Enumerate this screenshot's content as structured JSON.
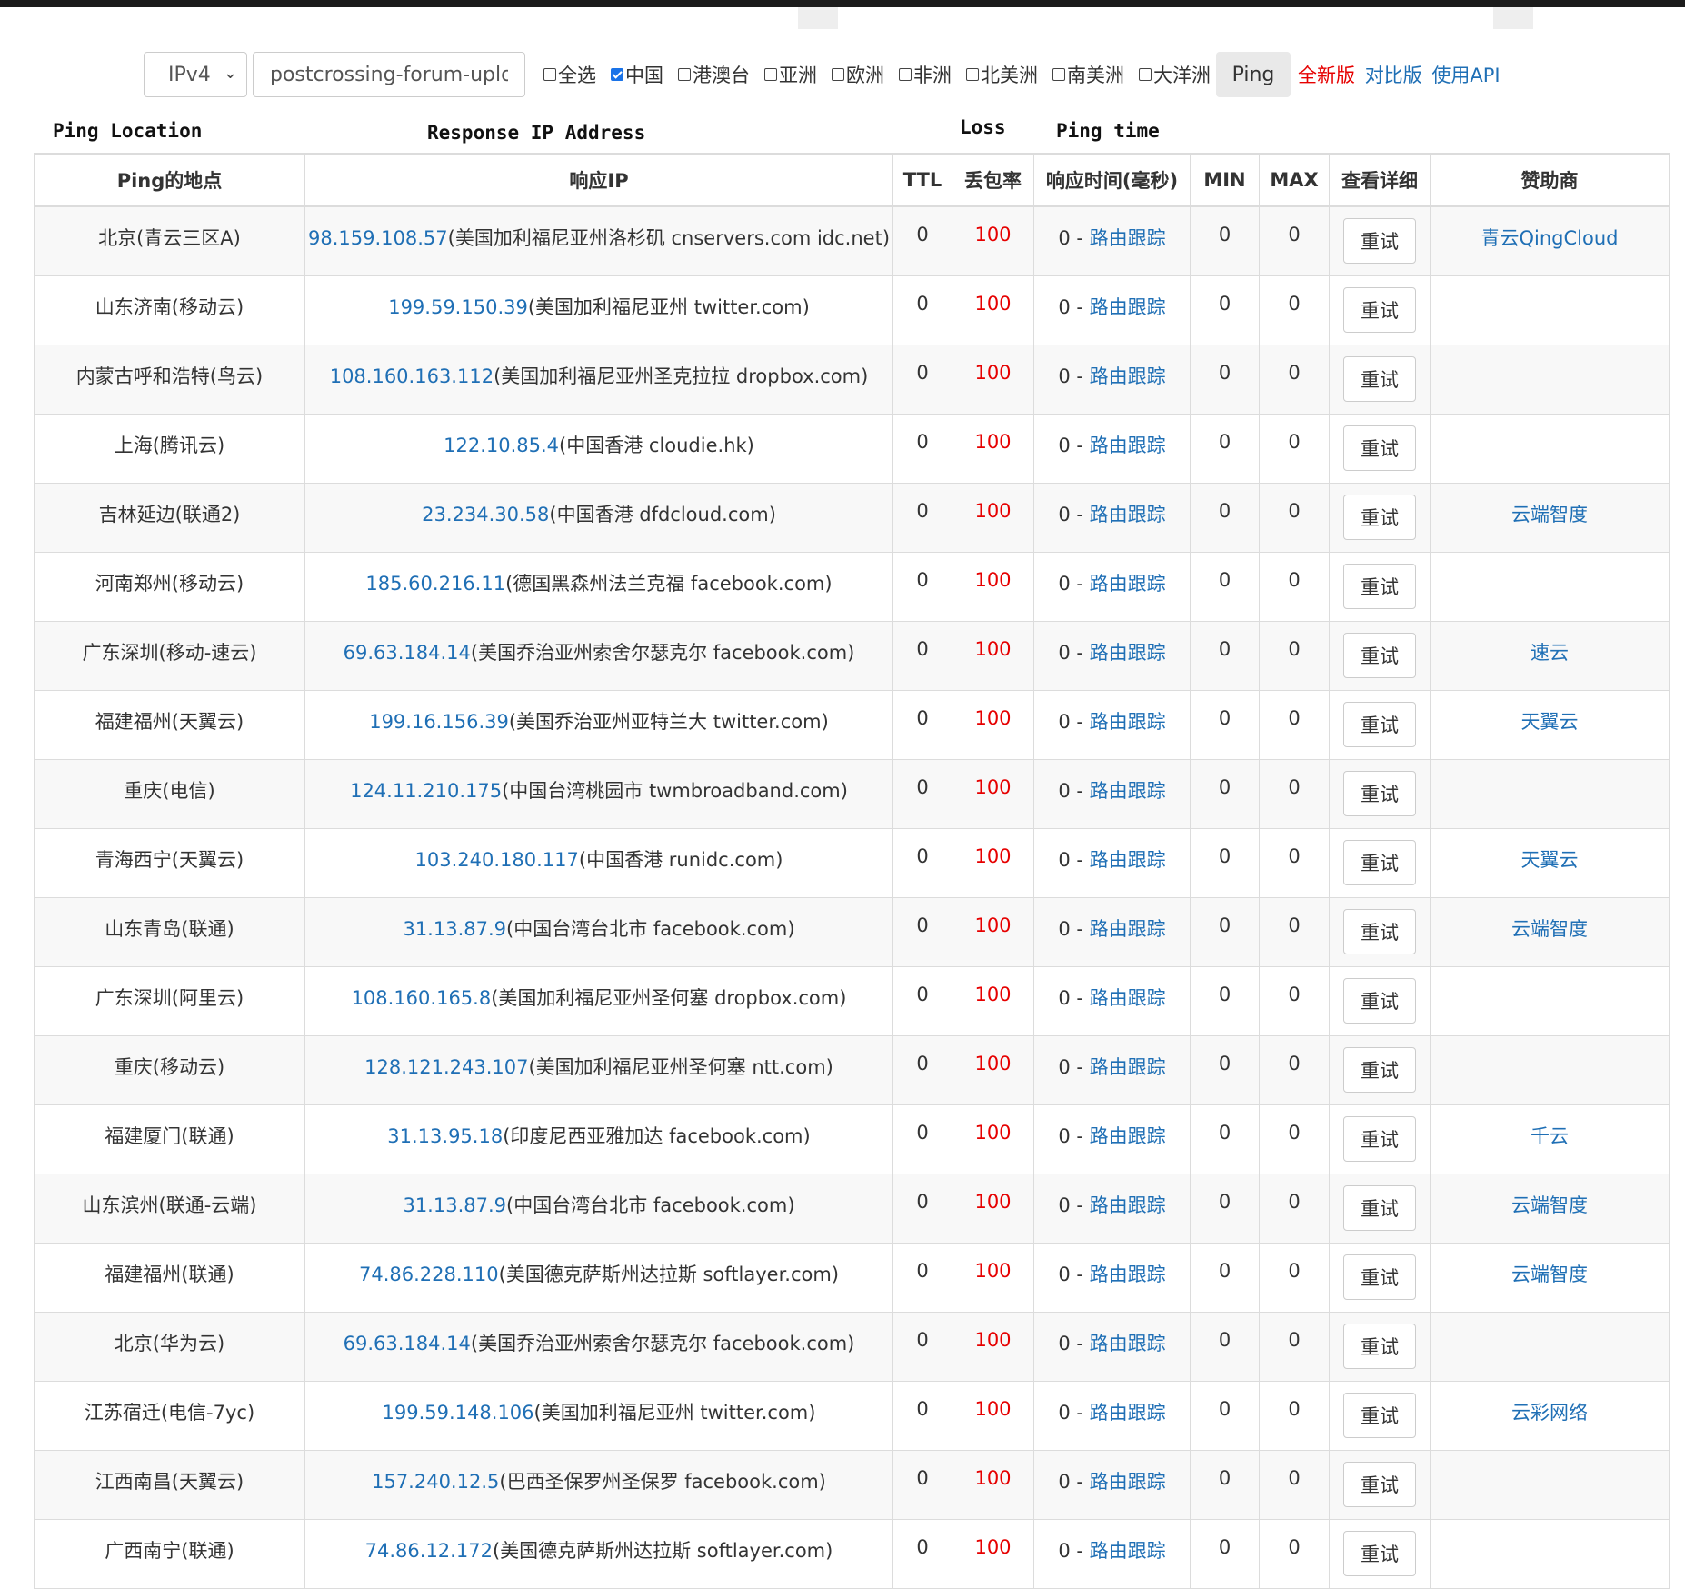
{
  "toolbar": {
    "ip_version": "IPv4",
    "host_value": "postcrossing-forum-uploa",
    "regions": [
      {
        "label": "全选",
        "checked": false
      },
      {
        "label": "中国",
        "checked": true
      },
      {
        "label": "港澳台",
        "checked": false
      },
      {
        "label": "亚洲",
        "checked": false
      },
      {
        "label": "欧洲",
        "checked": false
      },
      {
        "label": "非洲",
        "checked": false
      },
      {
        "label": "北美洲",
        "checked": false
      },
      {
        "label": "南美洲",
        "checked": false
      },
      {
        "label": "大洋洲",
        "checked": false
      }
    ],
    "ping_label": "Ping",
    "link_new": "全新版",
    "link_compare": "对比版",
    "link_api": "使用API"
  },
  "english_labels": {
    "location": "Ping Location",
    "ip": "Response IP Address",
    "loss": "Loss",
    "ping_time": "Ping time"
  },
  "table": {
    "headers": [
      "Ping的地点",
      "响应IP",
      "TTL",
      "丢包率",
      "响应时间(毫秒)",
      "MIN",
      "MAX",
      "查看详细",
      "赞助商"
    ],
    "trace_label": "路由跟踪",
    "retry_label": "重试",
    "rows": [
      {
        "location": "北京(青云三区A)",
        "ip": "98.159.108.57",
        "ip_info": "(美国加利福尼亚州洛杉矶 cnservers.com idc.net)",
        "ttl": "0",
        "loss": "100",
        "time": "0 - ",
        "min": "0",
        "max": "0",
        "sponsor": "青云QingCloud"
      },
      {
        "location": "山东济南(移动云)",
        "ip": "199.59.150.39",
        "ip_info": "(美国加利福尼亚州 twitter.com)",
        "ttl": "0",
        "loss": "100",
        "time": "0 - ",
        "min": "0",
        "max": "0",
        "sponsor": ""
      },
      {
        "location": "内蒙古呼和浩特(鸟云)",
        "ip": "108.160.163.112",
        "ip_info": "(美国加利福尼亚州圣克拉拉 dropbox.com)",
        "ttl": "0",
        "loss": "100",
        "time": "0 - ",
        "min": "0",
        "max": "0",
        "sponsor": ""
      },
      {
        "location": "上海(腾讯云)",
        "ip": "122.10.85.4",
        "ip_info": "(中国香港 cloudie.hk)",
        "ttl": "0",
        "loss": "100",
        "time": "0 - ",
        "min": "0",
        "max": "0",
        "sponsor": ""
      },
      {
        "location": "吉林延边(联通2)",
        "ip": "23.234.30.58",
        "ip_info": "(中国香港 dfdcloud.com)",
        "ttl": "0",
        "loss": "100",
        "time": "0 - ",
        "min": "0",
        "max": "0",
        "sponsor": "云端智度"
      },
      {
        "location": "河南郑州(移动云)",
        "ip": "185.60.216.11",
        "ip_info": "(德国黑森州法兰克福 facebook.com)",
        "ttl": "0",
        "loss": "100",
        "time": "0 - ",
        "min": "0",
        "max": "0",
        "sponsor": ""
      },
      {
        "location": "广东深圳(移动-速云)",
        "ip": "69.63.184.14",
        "ip_info": "(美国乔治亚州索舍尔瑟克尔 facebook.com)",
        "ttl": "0",
        "loss": "100",
        "time": "0 - ",
        "min": "0",
        "max": "0",
        "sponsor": "速云"
      },
      {
        "location": "福建福州(天翼云)",
        "ip": "199.16.156.39",
        "ip_info": "(美国乔治亚州亚特兰大 twitter.com)",
        "ttl": "0",
        "loss": "100",
        "time": "0 - ",
        "min": "0",
        "max": "0",
        "sponsor": "天翼云"
      },
      {
        "location": "重庆(电信)",
        "ip": "124.11.210.175",
        "ip_info": "(中国台湾桃园市 twmbroadband.com)",
        "ttl": "0",
        "loss": "100",
        "time": "0 - ",
        "min": "0",
        "max": "0",
        "sponsor": ""
      },
      {
        "location": "青海西宁(天翼云)",
        "ip": "103.240.180.117",
        "ip_info": "(中国香港 runidc.com)",
        "ttl": "0",
        "loss": "100",
        "time": "0 - ",
        "min": "0",
        "max": "0",
        "sponsor": "天翼云"
      },
      {
        "location": "山东青岛(联通)",
        "ip": "31.13.87.9",
        "ip_info": "(中国台湾台北市 facebook.com)",
        "ttl": "0",
        "loss": "100",
        "time": "0 - ",
        "min": "0",
        "max": "0",
        "sponsor": "云端智度"
      },
      {
        "location": "广东深圳(阿里云)",
        "ip": "108.160.165.8",
        "ip_info": "(美国加利福尼亚州圣何塞 dropbox.com)",
        "ttl": "0",
        "loss": "100",
        "time": "0 - ",
        "min": "0",
        "max": "0",
        "sponsor": ""
      },
      {
        "location": "重庆(移动云)",
        "ip": "128.121.243.107",
        "ip_info": "(美国加利福尼亚州圣何塞 ntt.com)",
        "ttl": "0",
        "loss": "100",
        "time": "0 - ",
        "min": "0",
        "max": "0",
        "sponsor": ""
      },
      {
        "location": "福建厦门(联通)",
        "ip": "31.13.95.18",
        "ip_info": "(印度尼西亚雅加达 facebook.com)",
        "ttl": "0",
        "loss": "100",
        "time": "0 - ",
        "min": "0",
        "max": "0",
        "sponsor": "千云"
      },
      {
        "location": "山东滨州(联通-云端)",
        "ip": "31.13.87.9",
        "ip_info": "(中国台湾台北市 facebook.com)",
        "ttl": "0",
        "loss": "100",
        "time": "0 - ",
        "min": "0",
        "max": "0",
        "sponsor": "云端智度"
      },
      {
        "location": "福建福州(联通)",
        "ip": "74.86.228.110",
        "ip_info": "(美国德克萨斯州达拉斯 softlayer.com)",
        "ttl": "0",
        "loss": "100",
        "time": "0 - ",
        "min": "0",
        "max": "0",
        "sponsor": "云端智度"
      },
      {
        "location": "北京(华为云)",
        "ip": "69.63.184.14",
        "ip_info": "(美国乔治亚州索舍尔瑟克尔 facebook.com)",
        "ttl": "0",
        "loss": "100",
        "time": "0 - ",
        "min": "0",
        "max": "0",
        "sponsor": ""
      },
      {
        "location": "江苏宿迁(电信-7yc)",
        "ip": "199.59.148.106",
        "ip_info": "(美国加利福尼亚州 twitter.com)",
        "ttl": "0",
        "loss": "100",
        "time": "0 - ",
        "min": "0",
        "max": "0",
        "sponsor": "云彩网络"
      },
      {
        "location": "江西南昌(天翼云)",
        "ip": "157.240.12.5",
        "ip_info": "(巴西圣保罗州圣保罗 facebook.com)",
        "ttl": "0",
        "loss": "100",
        "time": "0 - ",
        "min": "0",
        "max": "0",
        "sponsor": ""
      },
      {
        "location": "广西南宁(联通)",
        "ip": "74.86.12.172",
        "ip_info": "(美国德克萨斯州达拉斯 softlayer.com)",
        "ttl": "0",
        "loss": "100",
        "time": "0 - ",
        "min": "0",
        "max": "0",
        "sponsor": ""
      }
    ]
  }
}
